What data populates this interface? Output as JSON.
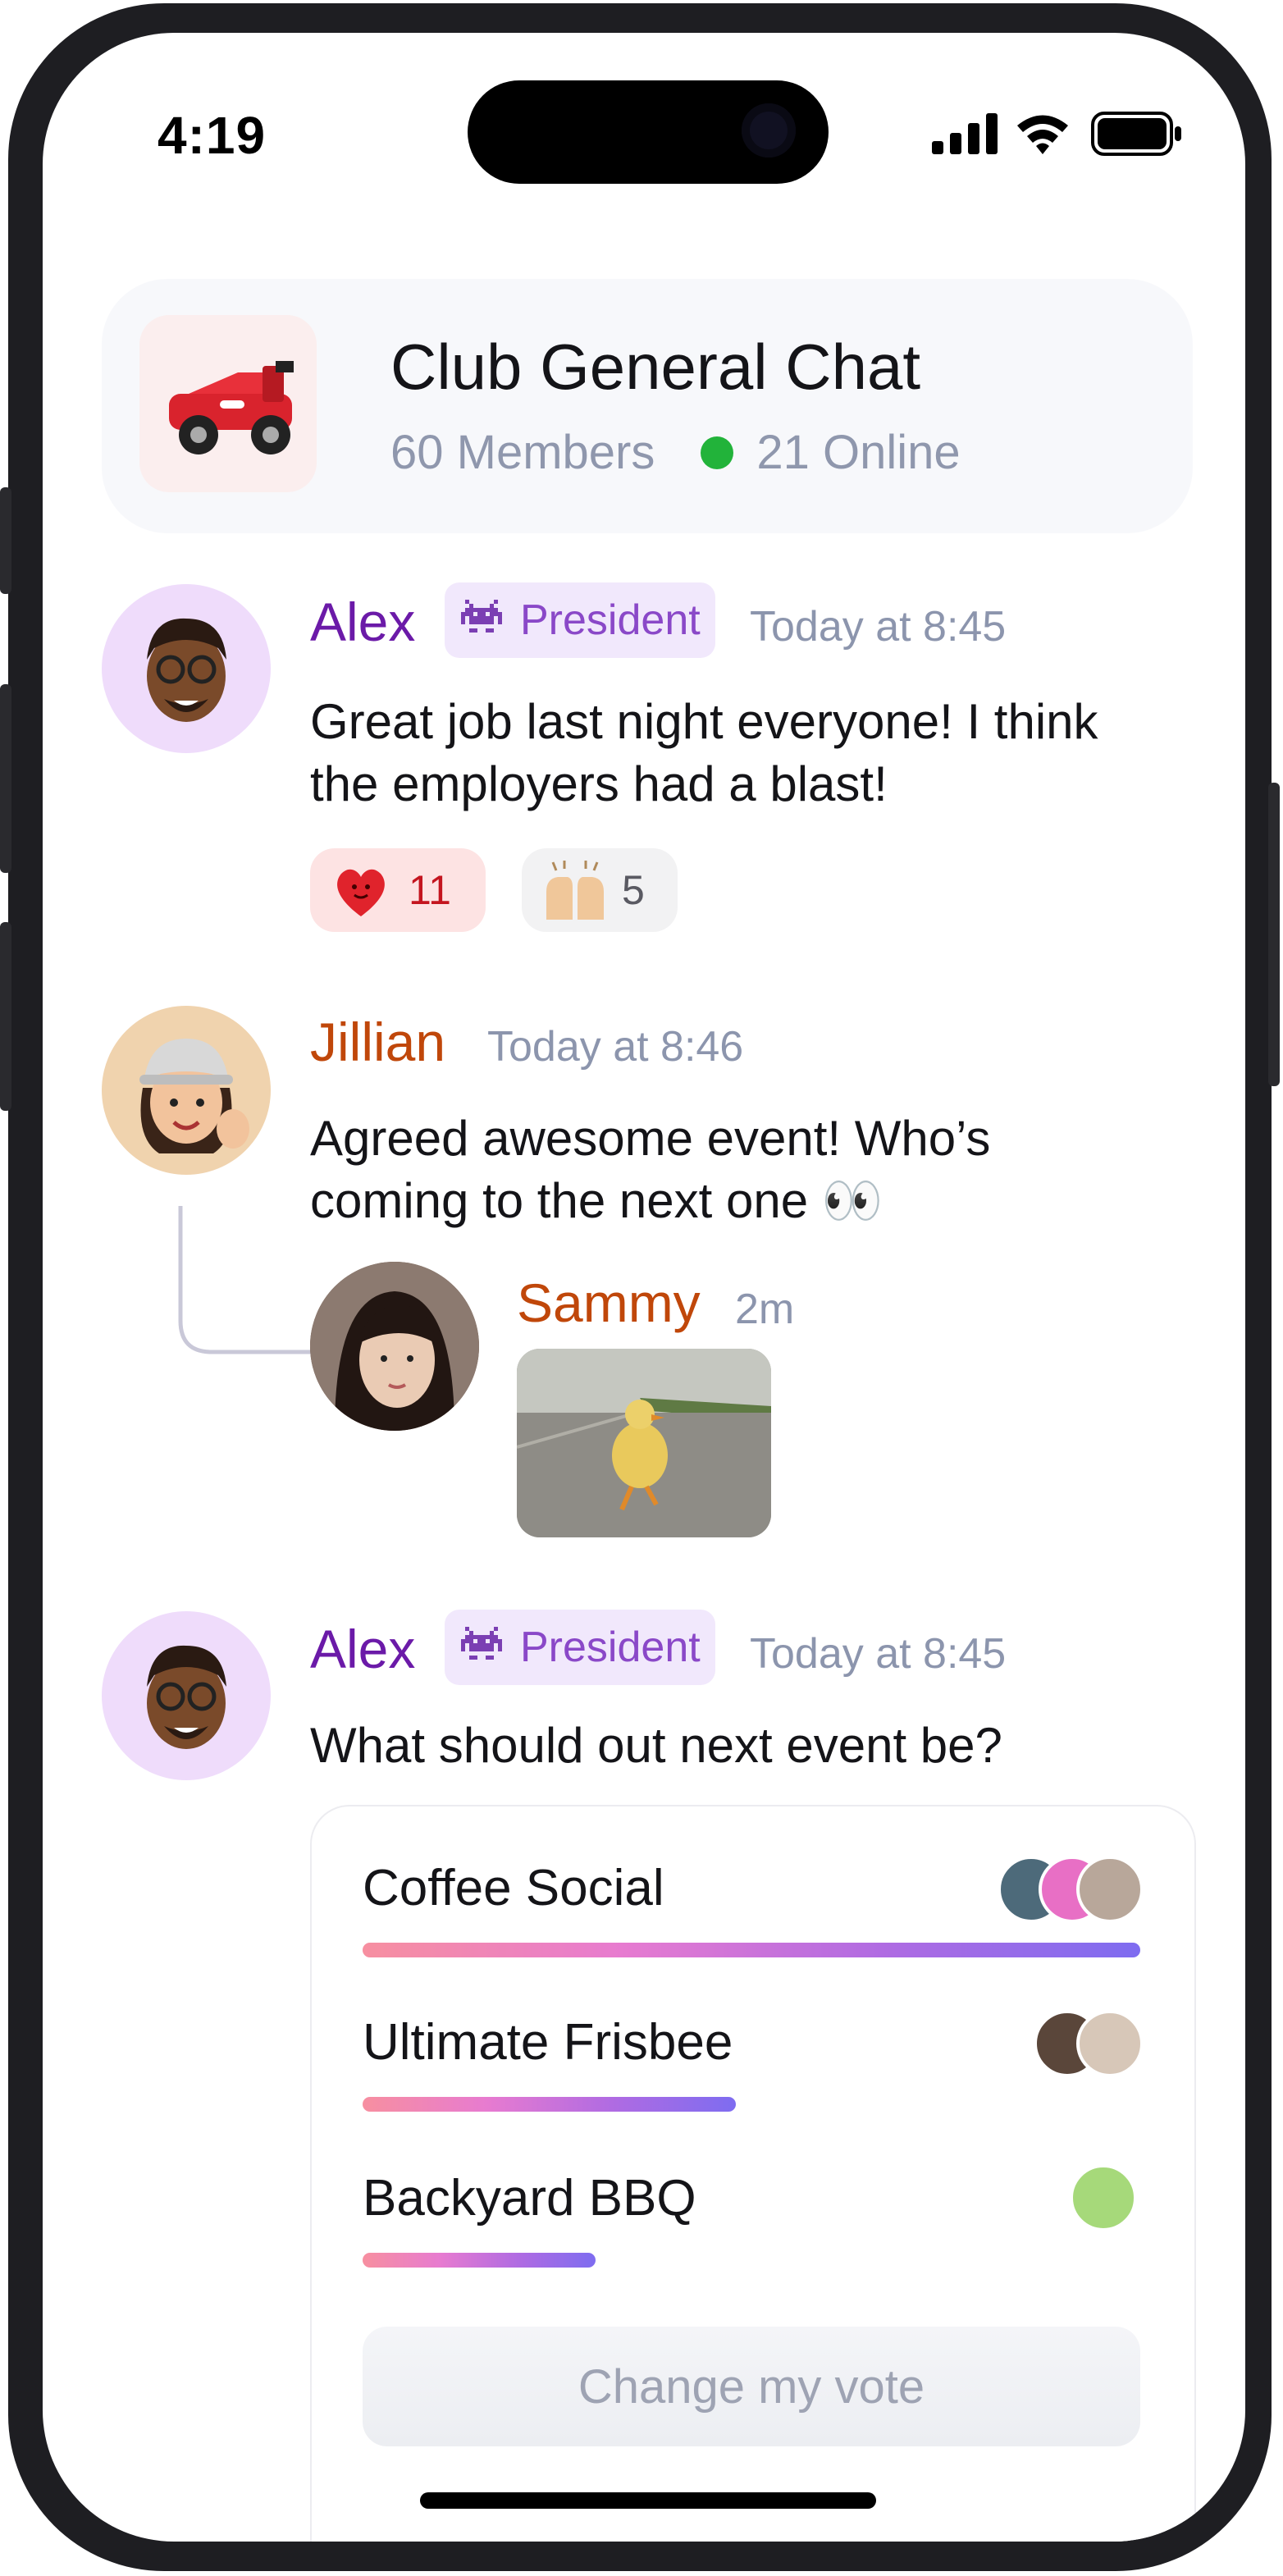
{
  "status_bar": {
    "time": "4:19"
  },
  "header": {
    "title": "Club General Chat",
    "members": "60 Members",
    "online": "21 Online",
    "icon": "race-car-icon",
    "online_color": "#22b33a"
  },
  "messages": [
    {
      "author": "Alex",
      "role": "President",
      "timestamp": "Today at 8:45",
      "text_line1": "Great job last night everyone! I think",
      "text_line2": "the employers had a blast!",
      "reactions": [
        {
          "icon": "heart-character-icon",
          "count": "11"
        },
        {
          "icon": "raised-hands-icon",
          "count": "5"
        }
      ]
    },
    {
      "author": "Jillian",
      "timestamp": "Today at 8:46",
      "text_line1": "Agreed awesome event! Who’s",
      "text_line2": "coming to the next one 👀",
      "reply": {
        "author": "Sammy",
        "timestamp": "2m",
        "image": "duck-photo"
      }
    },
    {
      "author": "Alex",
      "role": "President",
      "timestamp": "Today at 8:45",
      "text": "What should out next event be?"
    }
  ],
  "poll": {
    "options": [
      {
        "label": "Coffee Social",
        "share": 1.0,
        "voters": 3
      },
      {
        "label": "Ultimate Frisbee",
        "share": 0.48,
        "voters": 2
      },
      {
        "label": "Backyard BBQ",
        "share": 0.3,
        "voters": 1
      }
    ],
    "change_vote_label": "Change my vote"
  },
  "colors": {
    "alex": "#6b1aa8",
    "jillian": "#c0470a",
    "sammy": "#c0470a",
    "badge_bg": "#f1e8fc"
  }
}
